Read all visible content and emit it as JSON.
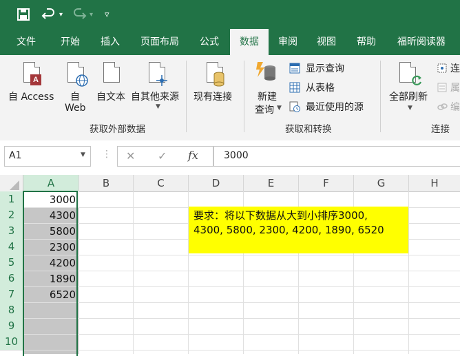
{
  "titlebar": {
    "save_icon": "save-icon",
    "undo_icon": "undo-icon",
    "redo_icon": "redo-icon",
    "customize_icon": "customize-qat-icon"
  },
  "tabs": [
    "文件",
    "开始",
    "插入",
    "页面布局",
    "公式",
    "数据",
    "审阅",
    "视图",
    "帮助",
    "福昕阅读器"
  ],
  "active_tab": "数据",
  "ribbon": {
    "external": {
      "from_access": "自 Access",
      "from_web_1": "自",
      "from_web_2": "Web",
      "from_text": "自文本",
      "from_other": "自其他来源",
      "existing": "现有连接",
      "group": "获取外部数据"
    },
    "transform": {
      "new_query_1": "新建",
      "new_query_2": "查询",
      "show_query": "显示查询",
      "from_table": "从表格",
      "recent_sources": "最近使用的源",
      "group": "获取和转换"
    },
    "connections": {
      "refresh_all": "全部刷新",
      "connections": "连",
      "properties": "属",
      "edit_links": "编",
      "group": "连接"
    }
  },
  "formula_bar": {
    "name_box": "A1",
    "cancel": "✕",
    "enter": "✓",
    "fx": "fx",
    "value": "3000"
  },
  "grid": {
    "columns": [
      "A",
      "B",
      "C",
      "D",
      "E",
      "F",
      "G",
      "H"
    ],
    "rows": [
      "1",
      "2",
      "3",
      "4",
      "5",
      "6",
      "7",
      "8",
      "9",
      "10"
    ],
    "column_a_values": [
      "3000",
      "4300",
      "5800",
      "2300",
      "4200",
      "1890",
      "6520"
    ],
    "note_line1": "要求：将以下数据从大到小排序3000,",
    "note_line2": "4300, 5800, 2300, 4200, 1890, 6520"
  },
  "colors": {
    "excel_green": "#217346",
    "note_yellow": "#ffff00",
    "selection_gray": "#c6c6c6"
  }
}
